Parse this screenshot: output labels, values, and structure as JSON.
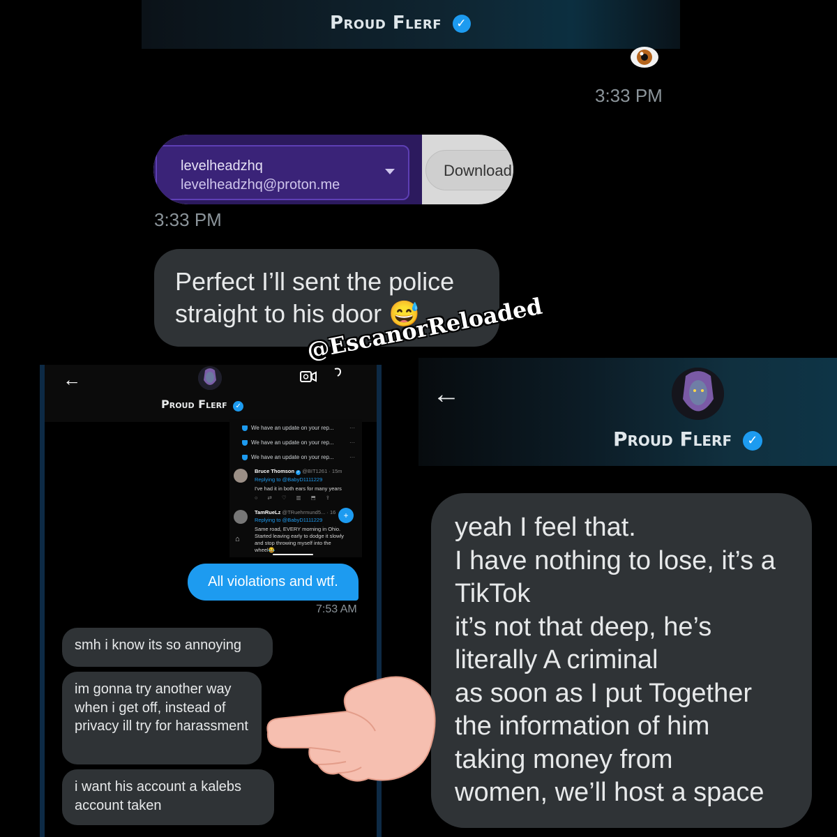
{
  "top_header": {
    "name": "Proud Flerf",
    "timestamp": "3:33 PM"
  },
  "email_widget": {
    "username": "levelheadzhq",
    "email": "levelheadzhq@proton.me",
    "download_label": "Download",
    "timestamp": "3:33 PM"
  },
  "messages": {
    "perfect": "Perfect I’ll sent the police straight to his door 😅"
  },
  "watermark": "@EscanorReloaded",
  "left_screenshot": {
    "name": "Proud Flerf",
    "notifications": [
      "We have an update on your rep...",
      "We have an update on your rep...",
      "We have an update on your rep..."
    ],
    "tweet1": {
      "author": "Bruce Thomson",
      "handle": "@BIT1261 · 15m",
      "replying": "Replying to @BabyD1111229",
      "text": "I've had it in both ears for many years"
    },
    "tweet2": {
      "author": "TamRueLz",
      "handle": "@TRuehrmund5... · 16",
      "replying": "Replying to @BabyD1111229",
      "text_lines": [
        "Same road, EVERY morning in Ohio.",
        "Started leaving early to dodge it slowly",
        "and stop throwing myself into the",
        "wheel😂"
      ]
    },
    "sent_message": "All violations and wtf.",
    "sent_time": "7:53 AM",
    "replies": [
      "smh i know its so annoying",
      "im gonna try another way when i get off, instead of privacy ill try for harassment",
      "i want his account a kalebs account taken"
    ]
  },
  "right_screenshot": {
    "name": "Proud Flerf",
    "message_lines": [
      "yeah I feel that.",
      "I have nothing to lose, it’s a",
      "TikTok",
      "it’s not that deep, he’s",
      "literally A criminal",
      "as soon as I put Together",
      "the information of him",
      "taking money from",
      "women, we’ll host a space"
    ]
  },
  "colors": {
    "accent": "#1d9bf0",
    "bubble": "#2f3336",
    "email_purple": "#2c1a5e"
  }
}
